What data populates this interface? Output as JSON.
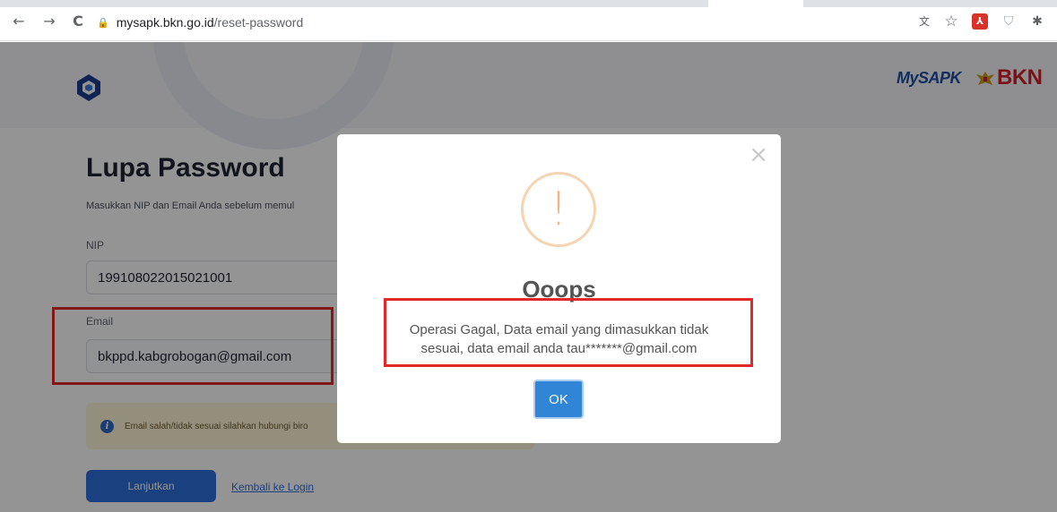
{
  "browser": {
    "url_host": "mysapk.bkn.go.id",
    "url_path": "/reset-password",
    "back_icon": "←",
    "forward_icon": "→",
    "reload_icon": "C",
    "lock_icon": "🔒",
    "translate_icon": "文",
    "star_icon": "☆",
    "pdf_icon": "⅄",
    "shield_icon": "⛉",
    "puzzle_icon": "✱"
  },
  "header": {
    "logo_right_1": "MySAPK",
    "logo_right_2": "BKN"
  },
  "form": {
    "title": "Lupa Password",
    "subtitle": "Masukkan NIP dan Email Anda sebelum memul",
    "nip_label": "NIP",
    "nip_value": "199108022015021001",
    "email_label": "Email",
    "email_value": "bkppd.kabgrobogan@gmail.com",
    "info_icon": "i",
    "info_text": "Email salah/tidak sesuai silahkan hubungi biro",
    "submit_label": "Lanjutkan",
    "back_link": "Kembali ke Login"
  },
  "modal": {
    "close_icon": "×",
    "warning_icon": "!",
    "title": "Ooops",
    "message": "Operasi Gagal, Data email yang dimasukkan tidak sesuai, data email anda tau*******@gmail.com",
    "ok_label": "OK"
  },
  "colors": {
    "highlight_border": "#e02a2a",
    "primary_button": "#2f6fdb",
    "modal_ok": "#3085d6",
    "warning": "#f2b58a"
  }
}
